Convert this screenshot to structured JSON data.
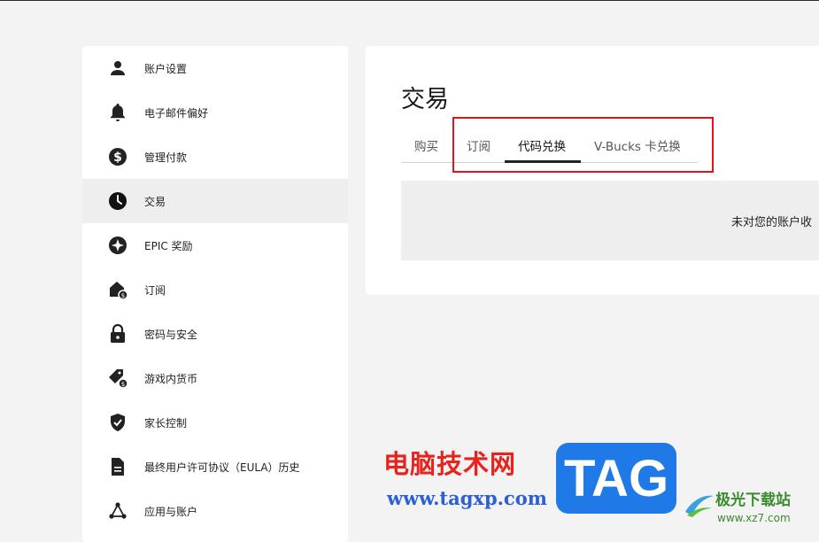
{
  "sidebar": {
    "items": [
      {
        "label": "账户设置",
        "icon": "person-icon"
      },
      {
        "label": "电子邮件偏好",
        "icon": "bell-icon"
      },
      {
        "label": "管理付款",
        "icon": "dollar-icon"
      },
      {
        "label": "交易",
        "icon": "clock-icon",
        "active": true
      },
      {
        "label": "EPIC 奖励",
        "icon": "star-badge-icon"
      },
      {
        "label": "订阅",
        "icon": "subscription-icon"
      },
      {
        "label": "密码与安全",
        "icon": "lock-icon"
      },
      {
        "label": "游戏内货币",
        "icon": "currency-tag-icon"
      },
      {
        "label": "家长控制",
        "icon": "shield-check-icon"
      },
      {
        "label": "最终用户许可协议（EULA）历史",
        "icon": "document-icon"
      },
      {
        "label": "应用与账户",
        "icon": "connections-icon"
      }
    ]
  },
  "main": {
    "title": "交易",
    "tabs": [
      {
        "label": "购买"
      },
      {
        "label": "订阅"
      },
      {
        "label": "代码兑换",
        "active": true
      },
      {
        "label": "V-Bucks 卡兑换"
      }
    ],
    "empty_message": "未对您的账户收"
  },
  "watermark": {
    "site_cn": "电脑技术网",
    "site_url": "www.tagxp.com",
    "tag": "TAG",
    "jg_name": "极光下载站",
    "jg_url": "www.xz7.com"
  },
  "colors": {
    "highlight": "#e0141e",
    "tag_bg": "#1f7ae8"
  }
}
